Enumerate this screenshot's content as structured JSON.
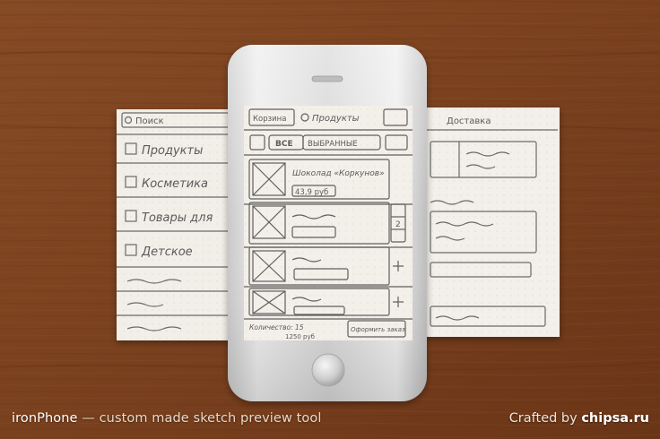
{
  "caption": {
    "product": "ironPhone",
    "tagline": "— custom made sketch preview tool",
    "credit_prefix": "Crafted by",
    "credit_site": "chipsa.ru"
  },
  "sketch": {
    "left_panel": {
      "search": "Поиск",
      "items": [
        "Продукты",
        "Косметика",
        "Товары для",
        "Детское"
      ]
    },
    "screen": {
      "header_left": "Корзина",
      "header_title": "Продукты",
      "tabs": [
        "ВСЕ",
        "ВЫБРАННЫЕ"
      ],
      "product_name": "Шоколад «Коркунов»",
      "product_price": "43,9 руб",
      "qty": "2",
      "footer_left": "Количество: 15",
      "footer_sub": "1250 руб",
      "footer_button": "Оформить заказ"
    },
    "right_panel": {
      "header": "Доставка"
    }
  },
  "colors": {
    "wood": "#7a4322",
    "paper": "#f3efea",
    "metal": "#d9d9d9",
    "pencil": "#5b5b5b"
  }
}
